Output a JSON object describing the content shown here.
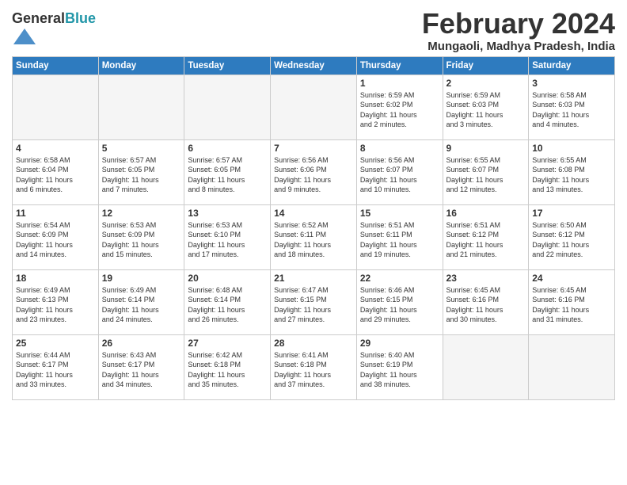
{
  "header": {
    "logo_general": "General",
    "logo_blue": "Blue",
    "month_title": "February 2024",
    "location": "Mungaoli, Madhya Pradesh, India"
  },
  "days_of_week": [
    "Sunday",
    "Monday",
    "Tuesday",
    "Wednesday",
    "Thursday",
    "Friday",
    "Saturday"
  ],
  "weeks": [
    [
      {
        "day": "",
        "info": ""
      },
      {
        "day": "",
        "info": ""
      },
      {
        "day": "",
        "info": ""
      },
      {
        "day": "",
        "info": ""
      },
      {
        "day": "1",
        "info": "Sunrise: 6:59 AM\nSunset: 6:02 PM\nDaylight: 11 hours\nand 2 minutes."
      },
      {
        "day": "2",
        "info": "Sunrise: 6:59 AM\nSunset: 6:03 PM\nDaylight: 11 hours\nand 3 minutes."
      },
      {
        "day": "3",
        "info": "Sunrise: 6:58 AM\nSunset: 6:03 PM\nDaylight: 11 hours\nand 4 minutes."
      }
    ],
    [
      {
        "day": "4",
        "info": "Sunrise: 6:58 AM\nSunset: 6:04 PM\nDaylight: 11 hours\nand 6 minutes."
      },
      {
        "day": "5",
        "info": "Sunrise: 6:57 AM\nSunset: 6:05 PM\nDaylight: 11 hours\nand 7 minutes."
      },
      {
        "day": "6",
        "info": "Sunrise: 6:57 AM\nSunset: 6:05 PM\nDaylight: 11 hours\nand 8 minutes."
      },
      {
        "day": "7",
        "info": "Sunrise: 6:56 AM\nSunset: 6:06 PM\nDaylight: 11 hours\nand 9 minutes."
      },
      {
        "day": "8",
        "info": "Sunrise: 6:56 AM\nSunset: 6:07 PM\nDaylight: 11 hours\nand 10 minutes."
      },
      {
        "day": "9",
        "info": "Sunrise: 6:55 AM\nSunset: 6:07 PM\nDaylight: 11 hours\nand 12 minutes."
      },
      {
        "day": "10",
        "info": "Sunrise: 6:55 AM\nSunset: 6:08 PM\nDaylight: 11 hours\nand 13 minutes."
      }
    ],
    [
      {
        "day": "11",
        "info": "Sunrise: 6:54 AM\nSunset: 6:09 PM\nDaylight: 11 hours\nand 14 minutes."
      },
      {
        "day": "12",
        "info": "Sunrise: 6:53 AM\nSunset: 6:09 PM\nDaylight: 11 hours\nand 15 minutes."
      },
      {
        "day": "13",
        "info": "Sunrise: 6:53 AM\nSunset: 6:10 PM\nDaylight: 11 hours\nand 17 minutes."
      },
      {
        "day": "14",
        "info": "Sunrise: 6:52 AM\nSunset: 6:11 PM\nDaylight: 11 hours\nand 18 minutes."
      },
      {
        "day": "15",
        "info": "Sunrise: 6:51 AM\nSunset: 6:11 PM\nDaylight: 11 hours\nand 19 minutes."
      },
      {
        "day": "16",
        "info": "Sunrise: 6:51 AM\nSunset: 6:12 PM\nDaylight: 11 hours\nand 21 minutes."
      },
      {
        "day": "17",
        "info": "Sunrise: 6:50 AM\nSunset: 6:12 PM\nDaylight: 11 hours\nand 22 minutes."
      }
    ],
    [
      {
        "day": "18",
        "info": "Sunrise: 6:49 AM\nSunset: 6:13 PM\nDaylight: 11 hours\nand 23 minutes."
      },
      {
        "day": "19",
        "info": "Sunrise: 6:49 AM\nSunset: 6:14 PM\nDaylight: 11 hours\nand 24 minutes."
      },
      {
        "day": "20",
        "info": "Sunrise: 6:48 AM\nSunset: 6:14 PM\nDaylight: 11 hours\nand 26 minutes."
      },
      {
        "day": "21",
        "info": "Sunrise: 6:47 AM\nSunset: 6:15 PM\nDaylight: 11 hours\nand 27 minutes."
      },
      {
        "day": "22",
        "info": "Sunrise: 6:46 AM\nSunset: 6:15 PM\nDaylight: 11 hours\nand 29 minutes."
      },
      {
        "day": "23",
        "info": "Sunrise: 6:45 AM\nSunset: 6:16 PM\nDaylight: 11 hours\nand 30 minutes."
      },
      {
        "day": "24",
        "info": "Sunrise: 6:45 AM\nSunset: 6:16 PM\nDaylight: 11 hours\nand 31 minutes."
      }
    ],
    [
      {
        "day": "25",
        "info": "Sunrise: 6:44 AM\nSunset: 6:17 PM\nDaylight: 11 hours\nand 33 minutes."
      },
      {
        "day": "26",
        "info": "Sunrise: 6:43 AM\nSunset: 6:17 PM\nDaylight: 11 hours\nand 34 minutes."
      },
      {
        "day": "27",
        "info": "Sunrise: 6:42 AM\nSunset: 6:18 PM\nDaylight: 11 hours\nand 35 minutes."
      },
      {
        "day": "28",
        "info": "Sunrise: 6:41 AM\nSunset: 6:18 PM\nDaylight: 11 hours\nand 37 minutes."
      },
      {
        "day": "29",
        "info": "Sunrise: 6:40 AM\nSunset: 6:19 PM\nDaylight: 11 hours\nand 38 minutes."
      },
      {
        "day": "",
        "info": ""
      },
      {
        "day": "",
        "info": ""
      }
    ]
  ]
}
